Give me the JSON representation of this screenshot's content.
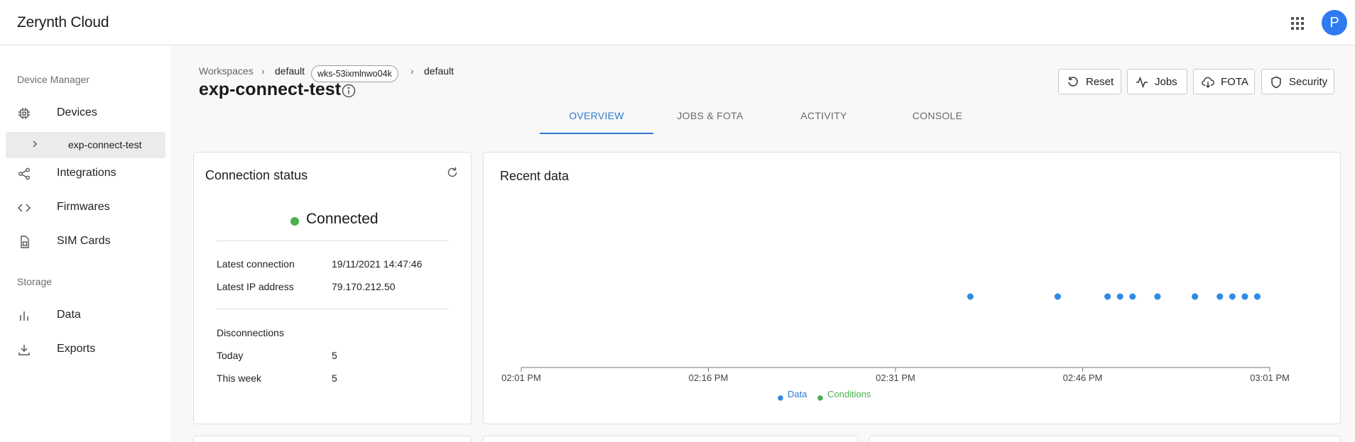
{
  "app": {
    "title": "Zerynth Cloud",
    "avatar_letter": "P"
  },
  "sidebar": {
    "section_device_manager": "Device Manager",
    "devices_label": "Devices",
    "device_sub_item": "exp-connect-test",
    "integrations_label": "Integrations",
    "firmwares_label": "Firmwares",
    "sim_cards_label": "SIM Cards",
    "section_storage": "Storage",
    "data_label": "Data",
    "exports_label": "Exports"
  },
  "breadcrumb": {
    "workspaces": "Workspaces",
    "sep1": "›",
    "workspace_name": "default",
    "workspace_id": "wks-53ixmlnwo04k",
    "sep2": "›",
    "fleet_name": "default"
  },
  "page": {
    "title": "exp-connect-test"
  },
  "toolbar": {
    "reset": "Reset",
    "jobs": "Jobs",
    "fota": "FOTA",
    "security": "Security"
  },
  "tabs": [
    "OVERVIEW",
    "JOBS & FOTA",
    "ACTIVITY",
    "CONSOLE"
  ],
  "connection": {
    "title": "Connection status",
    "status": "Connected",
    "status_color": "#4caf50",
    "latest_connection_label": "Latest connection",
    "latest_connection_value": "19/11/2021 14:47:46",
    "latest_ip_label": "Latest IP address",
    "latest_ip_value": "79.170.212.50",
    "disconnections_label": "Disconnections",
    "today_label": "Today",
    "today_value": "5",
    "week_label": "This week",
    "week_value": "5"
  },
  "recent_data": {
    "title": "Recent data"
  },
  "chart_data": {
    "type": "scatter",
    "x_unit": "minutes after 02:01 PM",
    "xlim": [
      "02:01 PM",
      "03:01 PM"
    ],
    "xticks": [
      "02:01 PM",
      "02:16 PM",
      "02:31 PM",
      "02:46 PM",
      "03:01 PM"
    ],
    "legend": [
      "Data",
      "Conditions"
    ],
    "legend_position": "bottom-center",
    "series": [
      {
        "name": "Data",
        "color": "#2f8be6",
        "x": [
          "02:37 PM",
          "02:44 PM",
          "02:44 PM",
          "02:48 PM",
          "02:48 PM",
          "02:49 PM",
          "02:50 PM",
          "02:52 PM",
          "02:52 PM",
          "02:55 PM",
          "02:55 PM",
          "02:57 PM",
          "02:57 PM",
          "02:58 PM",
          "02:59 PM",
          "02:59 PM",
          "03:00 PM",
          "03:00 PM"
        ]
      },
      {
        "name": "Conditions",
        "color": "#4caf50",
        "x": []
      }
    ]
  }
}
